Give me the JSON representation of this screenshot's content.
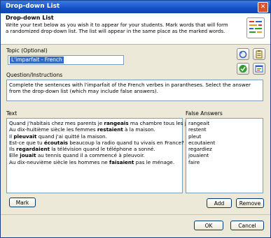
{
  "window": {
    "title": "Drop-down List",
    "close_glyph": "✕"
  },
  "header": {
    "heading": "Drop-down List",
    "description": "Write your text below as you wish it to appear for your students. Mark words that will form a randomized drop-down list. The list will appear in the same place as the marked words.",
    "icon": "list-lines-icon"
  },
  "topic": {
    "label": "Topic (Optional)",
    "value": "L'imparfait - French"
  },
  "question": {
    "label": "Question/Instructions",
    "text": "Complete the sentences with l'imparfait of the French verbes in parantheses. Select the answer from the drop-down list (which may include false answers)."
  },
  "text_section": {
    "label": "Text",
    "lines": [
      {
        "pre": "Quand j'habitais chez mes parents je ",
        "bold": "rangeais",
        "post": " ma chambre tous les jours."
      },
      {
        "pre": "Au dix-huitième siècle les femmes ",
        "bold": "restaient",
        "post": " à la maison."
      },
      {
        "pre": "Il ",
        "bold": "pleuvait",
        "post": " quand j'ai quitté la maison."
      },
      {
        "pre": "Est-ce que tu ",
        "bold": "écoutais",
        "post": " beaucoup la radio quand tu vivais en France?"
      },
      {
        "pre": "Ils ",
        "bold": "regardaient",
        "post": " la télévision quand le téléphone a sonné."
      },
      {
        "pre": "Elle ",
        "bold": "jouait",
        "post": " au tennis quand il a commencé à pleuvoir."
      },
      {
        "pre": "Au dix-neuvième siècle les hommes ne ",
        "bold": "faisaient",
        "post": " pas le ménage."
      }
    ]
  },
  "false_answers": {
    "label": "False Answers",
    "items": [
      "rangeait",
      "restent",
      "pleut",
      "ecoutaient",
      "regardiez",
      "jouaient",
      "faire"
    ]
  },
  "buttons": {
    "mark": "Mark",
    "add": "Add",
    "remove": "Remove",
    "ok": "OK",
    "cancel": "Cancel"
  },
  "toolbar_icons": [
    "undo-icon",
    "clipboard-icon",
    "check-icon",
    "preview-icon"
  ],
  "colors": {
    "title_bar": "#1450c8",
    "header_bg": "#ffffff",
    "dialog_bg": "#ece9d8",
    "selection": "#316ac5",
    "accent_green": "#2e9e2e"
  }
}
